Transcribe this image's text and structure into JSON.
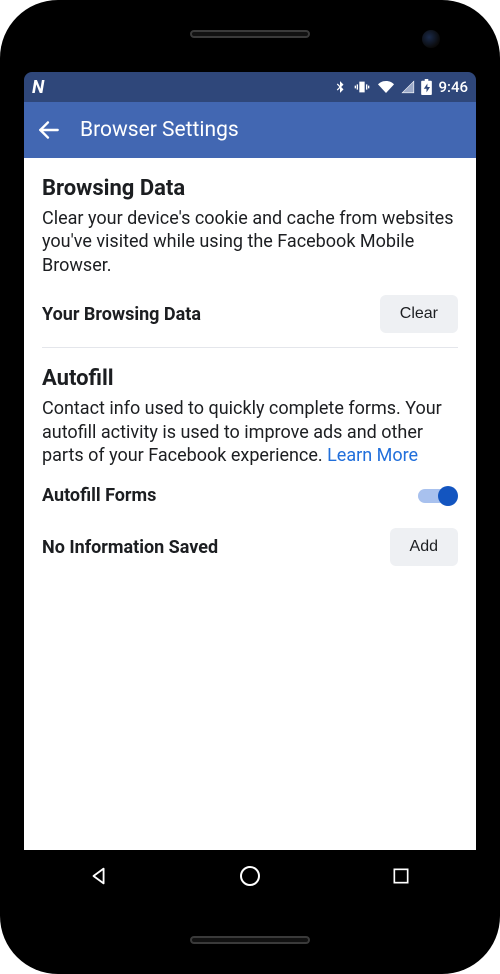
{
  "status": {
    "time": "9:46"
  },
  "appbar": {
    "title": "Browser Settings"
  },
  "sections": {
    "browsing": {
      "title": "Browsing Data",
      "desc": "Clear your device's cookie and cache from websites you've visited while using the Facebook Mobile Browser.",
      "row_label": "Your Browsing Data",
      "clear_btn": "Clear"
    },
    "autofill": {
      "title": "Autofill",
      "desc_prefix": "Contact info used to quickly complete forms. Your autofill activity is used to improve ads and other parts of your Facebook experience. ",
      "learn_more": "Learn More",
      "forms_label": "Autofill Forms",
      "forms_toggle_on": true,
      "no_info_label": "No Information Saved",
      "add_btn": "Add"
    }
  }
}
